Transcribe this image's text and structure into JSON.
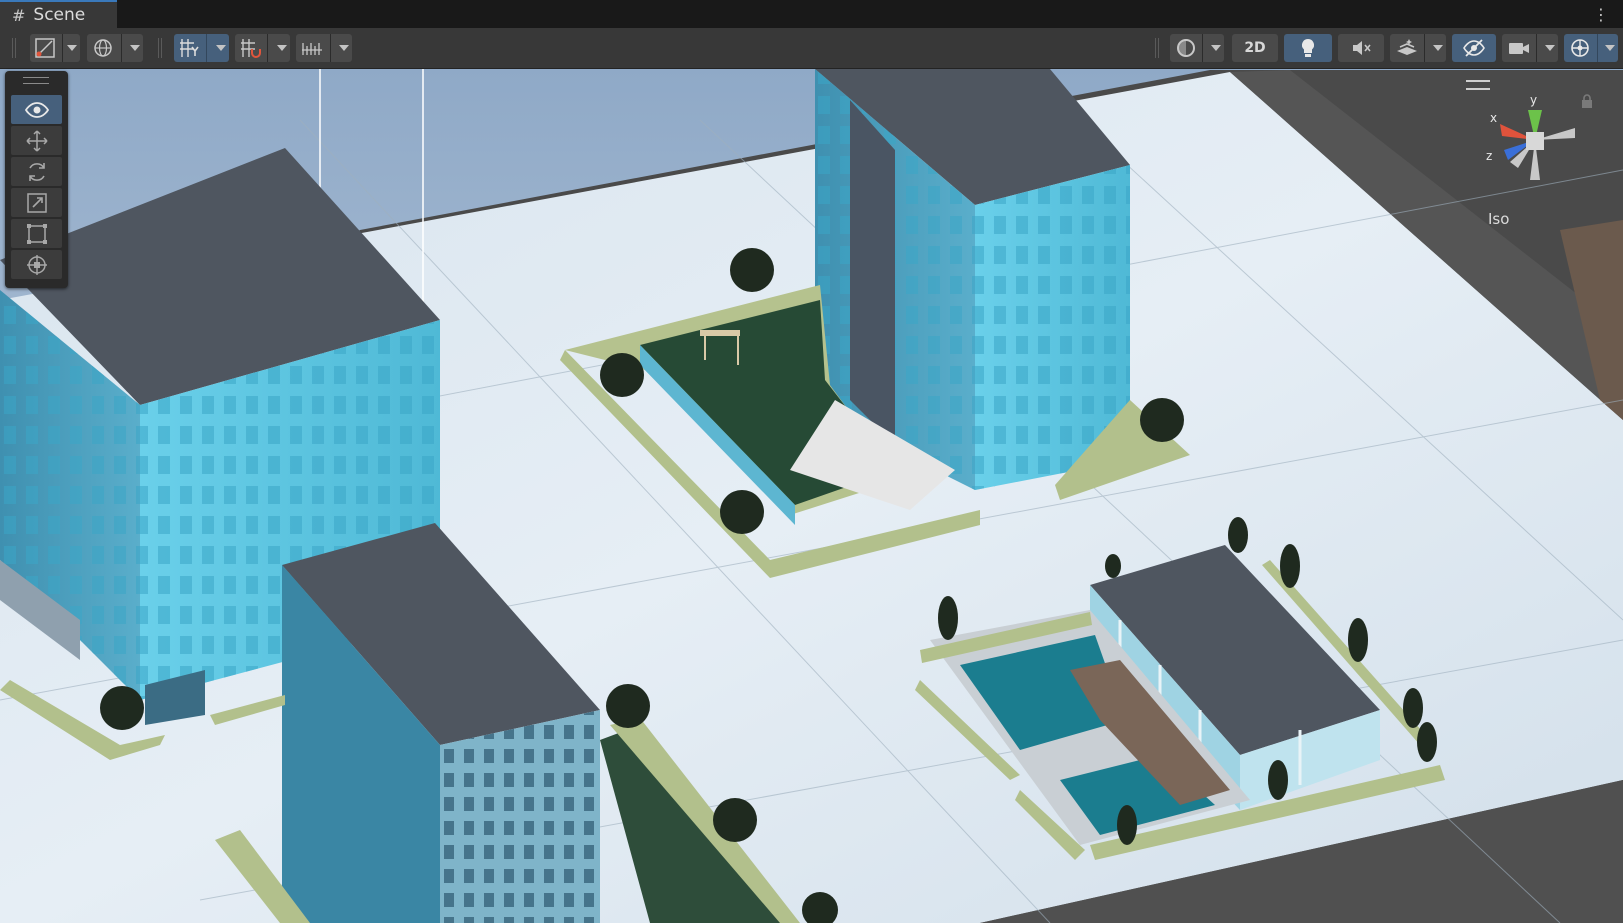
{
  "window": {
    "tab_icon": "#",
    "tab_title": "Scene",
    "menu_icon": "⋮"
  },
  "toolbar": {
    "tool_handle_label": "",
    "two_d_label": "2D"
  },
  "overlay_tools": [
    {
      "name": "view-tool",
      "icon": "eye-icon"
    },
    {
      "name": "move-tool",
      "icon": "move-arrows-icon"
    },
    {
      "name": "rotate-tool",
      "icon": "rotate-icon"
    },
    {
      "name": "scale-tool",
      "icon": "scale-icon"
    },
    {
      "name": "rect-tool",
      "icon": "rect-transform-icon"
    },
    {
      "name": "transform-tool",
      "icon": "transform-icon"
    }
  ],
  "orientation_gizmo": {
    "x_label": "x",
    "y_label": "y",
    "z_label": "z",
    "projection_label": "Iso"
  },
  "colors": {
    "accent": "#46607c",
    "toolbar_bg": "#383838",
    "tab_active_border": "#3a79bb"
  }
}
